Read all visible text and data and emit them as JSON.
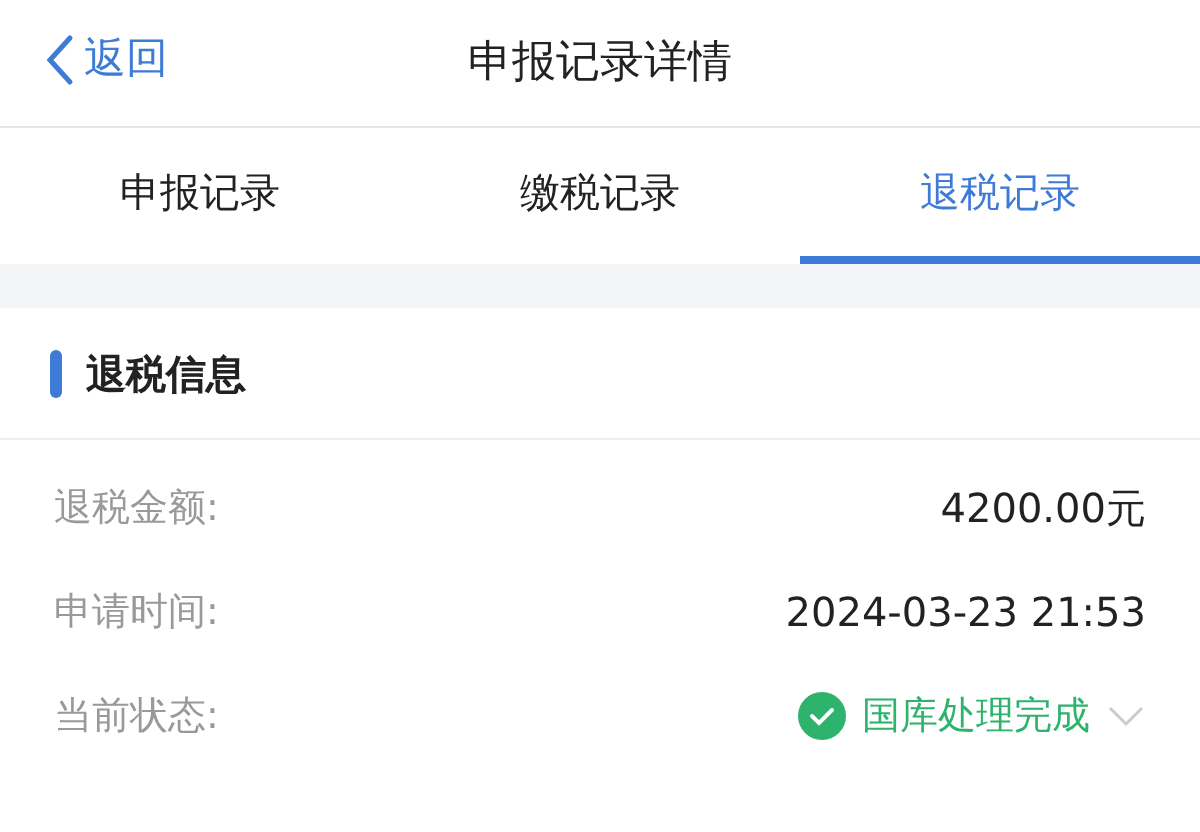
{
  "nav": {
    "back": "返回",
    "title": "申报记录详情"
  },
  "tabs": [
    {
      "label": "申报记录",
      "selected": false
    },
    {
      "label": "缴税记录",
      "selected": false
    },
    {
      "label": "退税记录",
      "selected": true
    }
  ],
  "section": {
    "title": "退税信息"
  },
  "rows": [
    {
      "kind": "text",
      "label": "退税金额:",
      "value": "4200.00元"
    },
    {
      "kind": "text",
      "label": "申请时间:",
      "value": "2024-03-23 21:53"
    },
    {
      "kind": "status",
      "label": "当前状态:",
      "value": "国库处理完成"
    }
  ]
}
